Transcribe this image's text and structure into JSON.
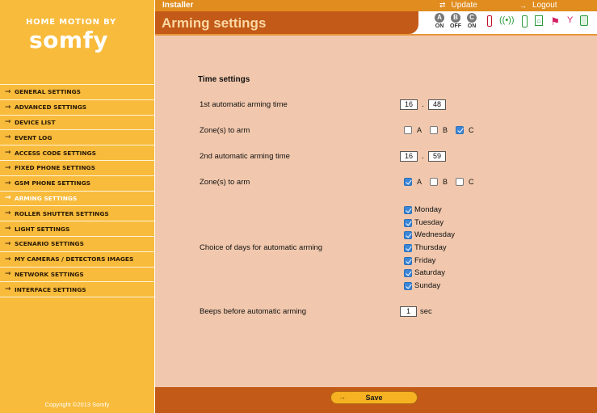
{
  "logo": {
    "top_text": "HOME MOTION BY",
    "brand": "somfy"
  },
  "sidebar": {
    "items": [
      {
        "label": "GENERAL SETTINGS"
      },
      {
        "label": "ADVANCED SETTINGS"
      },
      {
        "label": "DEVICE LIST"
      },
      {
        "label": "EVENT LOG"
      },
      {
        "label": "ACCESS CODE SETTINGS"
      },
      {
        "label": "FIXED PHONE SETTINGS"
      },
      {
        "label": "GSM PHONE SETTINGS"
      },
      {
        "label": "ARMING SETTINGS",
        "active": true
      },
      {
        "label": "ROLLER SHUTTER SETTINGS"
      },
      {
        "label": "LIGHT SETTINGS"
      },
      {
        "label": "SCENARIO SETTINGS"
      },
      {
        "label": "MY CAMERAS / DETECTORS IMAGES"
      },
      {
        "label": "NETWORK SETTINGS"
      },
      {
        "label": "INTERFACE SETTINGS"
      }
    ],
    "copyright": "Copyright ©2013 Somfy"
  },
  "topbar": {
    "user": "Installer",
    "update": "Update",
    "logout": "Logout"
  },
  "header": {
    "title": "Arming settings"
  },
  "status": {
    "zones": [
      {
        "letter": "A",
        "state": "ON"
      },
      {
        "letter": "B",
        "state": "OFF"
      },
      {
        "letter": "C",
        "state": "ON"
      }
    ],
    "icons": [
      "battery-icon",
      "wireless-signal-icon",
      "phone-icon",
      "house-icon",
      "flag-icon",
      "antenna-icon",
      "device-icon"
    ]
  },
  "form": {
    "section_title": "Time settings",
    "arming1": {
      "label": "1st automatic arming time",
      "hour": "16",
      "minute": "48",
      "separator": "."
    },
    "zones1": {
      "label": "Zone(s) to arm",
      "options": [
        {
          "label": "A",
          "checked": false
        },
        {
          "label": "B",
          "checked": false
        },
        {
          "label": "C",
          "checked": true
        }
      ]
    },
    "arming2": {
      "label": "2nd automatic arming time",
      "hour": "16",
      "minute": "59",
      "separator": "."
    },
    "zones2": {
      "label": "Zone(s) to arm",
      "options": [
        {
          "label": "A",
          "checked": true
        },
        {
          "label": "B",
          "checked": false
        },
        {
          "label": "C",
          "checked": false
        }
      ]
    },
    "days": {
      "label": "Choice of days for automatic arming",
      "items": [
        {
          "label": "Monday",
          "checked": true
        },
        {
          "label": "Tuesday",
          "checked": true
        },
        {
          "label": "Wednesday",
          "checked": true
        },
        {
          "label": "Thursday",
          "checked": true
        },
        {
          "label": "Friday",
          "checked": true
        },
        {
          "label": "Saturday",
          "checked": true
        },
        {
          "label": "Sunday",
          "checked": true
        }
      ]
    },
    "beeps": {
      "label": "Beeps before automatic arming",
      "value": "1",
      "unit": "sec"
    }
  },
  "footer": {
    "save_label": "Save"
  },
  "colors": {
    "sidebar_bg": "#f8bb3c",
    "accent": "#c35a18",
    "content_bg": "#f1c8ad",
    "checkbox_on": "#3b86d8"
  }
}
